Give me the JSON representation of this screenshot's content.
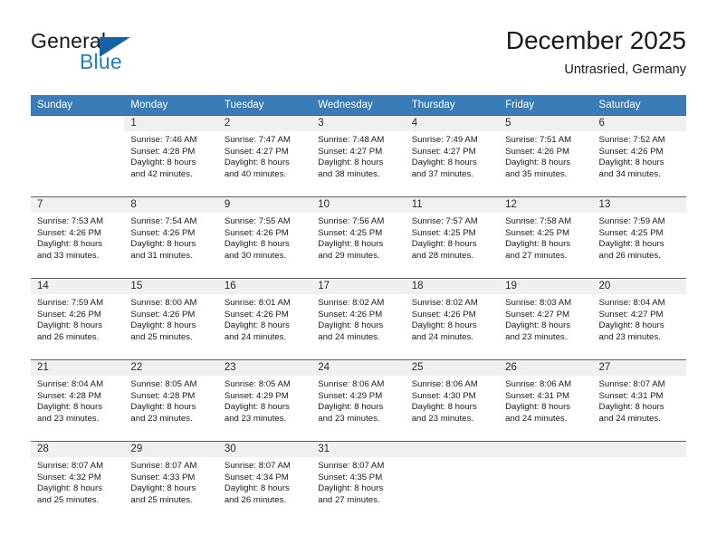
{
  "brand": {
    "name_top": "General",
    "name_bottom": "Blue",
    "triangle_icon": "triangle-icon",
    "color_primary": "#1464a5",
    "color_blue_text": "#1f7fc4"
  },
  "header": {
    "month_title": "December 2025",
    "location": "Untrasried, Germany"
  },
  "calendar": {
    "header_bg": "#3a7cb8",
    "day_headers": [
      "Sunday",
      "Monday",
      "Tuesday",
      "Wednesday",
      "Thursday",
      "Friday",
      "Saturday"
    ],
    "weeks": [
      [
        {
          "blank": true
        },
        {
          "day": "1",
          "sunrise": "Sunrise: 7:46 AM",
          "sunset": "Sunset: 4:28 PM",
          "daylight1": "Daylight: 8 hours",
          "daylight2": "and 42 minutes."
        },
        {
          "day": "2",
          "sunrise": "Sunrise: 7:47 AM",
          "sunset": "Sunset: 4:27 PM",
          "daylight1": "Daylight: 8 hours",
          "daylight2": "and 40 minutes."
        },
        {
          "day": "3",
          "sunrise": "Sunrise: 7:48 AM",
          "sunset": "Sunset: 4:27 PM",
          "daylight1": "Daylight: 8 hours",
          "daylight2": "and 38 minutes."
        },
        {
          "day": "4",
          "sunrise": "Sunrise: 7:49 AM",
          "sunset": "Sunset: 4:27 PM",
          "daylight1": "Daylight: 8 hours",
          "daylight2": "and 37 minutes."
        },
        {
          "day": "5",
          "sunrise": "Sunrise: 7:51 AM",
          "sunset": "Sunset: 4:26 PM",
          "daylight1": "Daylight: 8 hours",
          "daylight2": "and 35 minutes."
        },
        {
          "day": "6",
          "sunrise": "Sunrise: 7:52 AM",
          "sunset": "Sunset: 4:26 PM",
          "daylight1": "Daylight: 8 hours",
          "daylight2": "and 34 minutes."
        }
      ],
      [
        {
          "day": "7",
          "sunrise": "Sunrise: 7:53 AM",
          "sunset": "Sunset: 4:26 PM",
          "daylight1": "Daylight: 8 hours",
          "daylight2": "and 33 minutes."
        },
        {
          "day": "8",
          "sunrise": "Sunrise: 7:54 AM",
          "sunset": "Sunset: 4:26 PM",
          "daylight1": "Daylight: 8 hours",
          "daylight2": "and 31 minutes."
        },
        {
          "day": "9",
          "sunrise": "Sunrise: 7:55 AM",
          "sunset": "Sunset: 4:26 PM",
          "daylight1": "Daylight: 8 hours",
          "daylight2": "and 30 minutes."
        },
        {
          "day": "10",
          "sunrise": "Sunrise: 7:56 AM",
          "sunset": "Sunset: 4:25 PM",
          "daylight1": "Daylight: 8 hours",
          "daylight2": "and 29 minutes."
        },
        {
          "day": "11",
          "sunrise": "Sunrise: 7:57 AM",
          "sunset": "Sunset: 4:25 PM",
          "daylight1": "Daylight: 8 hours",
          "daylight2": "and 28 minutes."
        },
        {
          "day": "12",
          "sunrise": "Sunrise: 7:58 AM",
          "sunset": "Sunset: 4:25 PM",
          "daylight1": "Daylight: 8 hours",
          "daylight2": "and 27 minutes."
        },
        {
          "day": "13",
          "sunrise": "Sunrise: 7:59 AM",
          "sunset": "Sunset: 4:25 PM",
          "daylight1": "Daylight: 8 hours",
          "daylight2": "and 26 minutes."
        }
      ],
      [
        {
          "day": "14",
          "sunrise": "Sunrise: 7:59 AM",
          "sunset": "Sunset: 4:26 PM",
          "daylight1": "Daylight: 8 hours",
          "daylight2": "and 26 minutes."
        },
        {
          "day": "15",
          "sunrise": "Sunrise: 8:00 AM",
          "sunset": "Sunset: 4:26 PM",
          "daylight1": "Daylight: 8 hours",
          "daylight2": "and 25 minutes."
        },
        {
          "day": "16",
          "sunrise": "Sunrise: 8:01 AM",
          "sunset": "Sunset: 4:26 PM",
          "daylight1": "Daylight: 8 hours",
          "daylight2": "and 24 minutes."
        },
        {
          "day": "17",
          "sunrise": "Sunrise: 8:02 AM",
          "sunset": "Sunset: 4:26 PM",
          "daylight1": "Daylight: 8 hours",
          "daylight2": "and 24 minutes."
        },
        {
          "day": "18",
          "sunrise": "Sunrise: 8:02 AM",
          "sunset": "Sunset: 4:26 PM",
          "daylight1": "Daylight: 8 hours",
          "daylight2": "and 24 minutes."
        },
        {
          "day": "19",
          "sunrise": "Sunrise: 8:03 AM",
          "sunset": "Sunset: 4:27 PM",
          "daylight1": "Daylight: 8 hours",
          "daylight2": "and 23 minutes."
        },
        {
          "day": "20",
          "sunrise": "Sunrise: 8:04 AM",
          "sunset": "Sunset: 4:27 PM",
          "daylight1": "Daylight: 8 hours",
          "daylight2": "and 23 minutes."
        }
      ],
      [
        {
          "day": "21",
          "sunrise": "Sunrise: 8:04 AM",
          "sunset": "Sunset: 4:28 PM",
          "daylight1": "Daylight: 8 hours",
          "daylight2": "and 23 minutes."
        },
        {
          "day": "22",
          "sunrise": "Sunrise: 8:05 AM",
          "sunset": "Sunset: 4:28 PM",
          "daylight1": "Daylight: 8 hours",
          "daylight2": "and 23 minutes."
        },
        {
          "day": "23",
          "sunrise": "Sunrise: 8:05 AM",
          "sunset": "Sunset: 4:29 PM",
          "daylight1": "Daylight: 8 hours",
          "daylight2": "and 23 minutes."
        },
        {
          "day": "24",
          "sunrise": "Sunrise: 8:06 AM",
          "sunset": "Sunset: 4:29 PM",
          "daylight1": "Daylight: 8 hours",
          "daylight2": "and 23 minutes."
        },
        {
          "day": "25",
          "sunrise": "Sunrise: 8:06 AM",
          "sunset": "Sunset: 4:30 PM",
          "daylight1": "Daylight: 8 hours",
          "daylight2": "and 23 minutes."
        },
        {
          "day": "26",
          "sunrise": "Sunrise: 8:06 AM",
          "sunset": "Sunset: 4:31 PM",
          "daylight1": "Daylight: 8 hours",
          "daylight2": "and 24 minutes."
        },
        {
          "day": "27",
          "sunrise": "Sunrise: 8:07 AM",
          "sunset": "Sunset: 4:31 PM",
          "daylight1": "Daylight: 8 hours",
          "daylight2": "and 24 minutes."
        }
      ],
      [
        {
          "day": "28",
          "sunrise": "Sunrise: 8:07 AM",
          "sunset": "Sunset: 4:32 PM",
          "daylight1": "Daylight: 8 hours",
          "daylight2": "and 25 minutes."
        },
        {
          "day": "29",
          "sunrise": "Sunrise: 8:07 AM",
          "sunset": "Sunset: 4:33 PM",
          "daylight1": "Daylight: 8 hours",
          "daylight2": "and 25 minutes."
        },
        {
          "day": "30",
          "sunrise": "Sunrise: 8:07 AM",
          "sunset": "Sunset: 4:34 PM",
          "daylight1": "Daylight: 8 hours",
          "daylight2": "and 26 minutes."
        },
        {
          "day": "31",
          "sunrise": "Sunrise: 8:07 AM",
          "sunset": "Sunset: 4:35 PM",
          "daylight1": "Daylight: 8 hours",
          "daylight2": "and 27 minutes."
        },
        {
          "empty": true
        },
        {
          "empty": true
        },
        {
          "empty": true
        }
      ]
    ]
  }
}
